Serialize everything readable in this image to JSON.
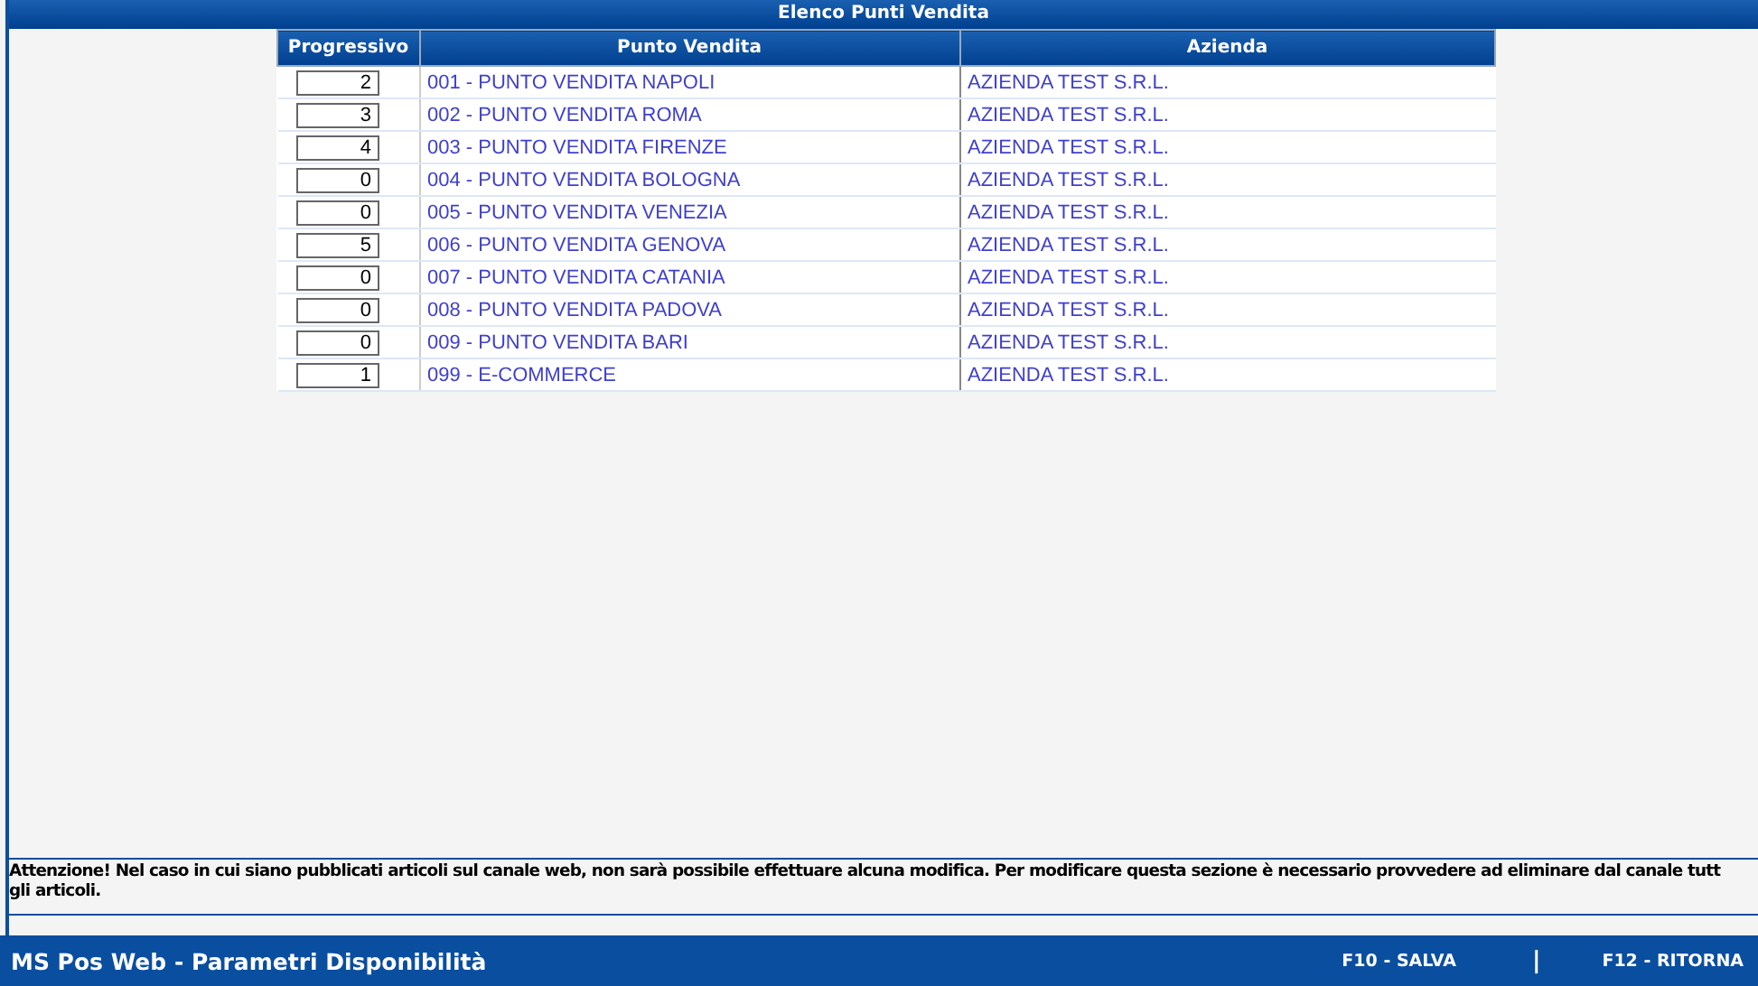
{
  "title": "Elenco Punti Vendita",
  "table": {
    "columns": [
      "Progressivo",
      "Punto Vendita",
      "Azienda"
    ],
    "rows": [
      {
        "progressivo": "2",
        "punto_vendita": "001 - PUNTO VENDITA NAPOLI",
        "azienda": "AZIENDA TEST S.R.L."
      },
      {
        "progressivo": "3",
        "punto_vendita": "002 - PUNTO VENDITA ROMA",
        "azienda": "AZIENDA TEST S.R.L."
      },
      {
        "progressivo": "4",
        "punto_vendita": "003 - PUNTO VENDITA FIRENZE",
        "azienda": "AZIENDA TEST S.R.L."
      },
      {
        "progressivo": "0",
        "punto_vendita": "004 - PUNTO VENDITA BOLOGNA",
        "azienda": "AZIENDA TEST S.R.L."
      },
      {
        "progressivo": "0",
        "punto_vendita": "005 - PUNTO VENDITA VENEZIA",
        "azienda": "AZIENDA TEST S.R.L."
      },
      {
        "progressivo": "5",
        "punto_vendita": "006 - PUNTO VENDITA GENOVA",
        "azienda": "AZIENDA TEST S.R.L."
      },
      {
        "progressivo": "0",
        "punto_vendita": "007 - PUNTO VENDITA CATANIA",
        "azienda": "AZIENDA TEST S.R.L."
      },
      {
        "progressivo": "0",
        "punto_vendita": "008 - PUNTO VENDITA PADOVA",
        "azienda": "AZIENDA TEST S.R.L."
      },
      {
        "progressivo": "0",
        "punto_vendita": "009 - PUNTO VENDITA BARI",
        "azienda": "AZIENDA TEST S.R.L."
      },
      {
        "progressivo": "1",
        "punto_vendita": "099 - E-COMMERCE",
        "azienda": "AZIENDA TEST S.R.L."
      }
    ]
  },
  "message_lines": [
    "Attenzione! Nel caso in cui siano pubblicati articoli sul canale web, non sarà possibile effettuare alcuna modifica. Per modificare questa sezione è necessario provvedere ad eliminare dal canale tutt",
    "gli articoli."
  ],
  "footer": {
    "app_title": "MS Pos Web - Parametri Disponibilità",
    "actions": [
      "F10 - SALVA",
      "F12 - RITORNA"
    ],
    "separator": "|"
  }
}
